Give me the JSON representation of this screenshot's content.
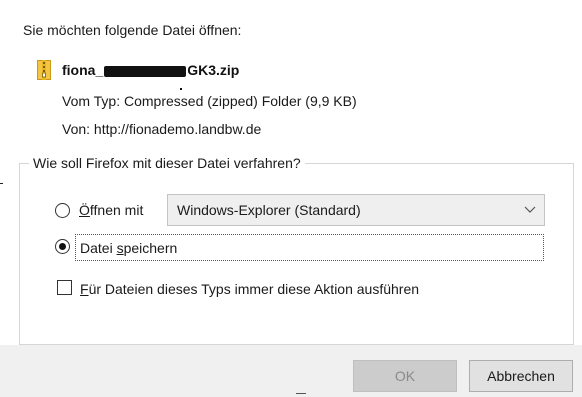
{
  "dialog": {
    "intro": "Sie möchten folgende Datei öffnen:",
    "file": {
      "name_start": "fiona_",
      "name_end": "GK3.zip",
      "icon": "zip-folder-icon",
      "type_label": "Vom Typ:",
      "type_value": "Compressed (zipped) Folder (9,9 KB)",
      "from_label": "Von:",
      "from_value": "http://fionademo.landbw.de"
    },
    "action_group": {
      "legend": "Wie soll Firefox mit dieser Datei verfahren?",
      "open_with": {
        "accel": "Ö",
        "label_rest": "ffnen mit",
        "checked": false,
        "app_selected": "Windows-Explorer (Standard)"
      },
      "save_file": {
        "label_pre": "Datei ",
        "accel": "s",
        "label_post": "peichern",
        "checked": true
      },
      "remember": {
        "accel": "F",
        "label_rest": "ür Dateien dieses Typs immer diese Aktion ausführen",
        "checked": false
      }
    },
    "buttons": {
      "ok": "OK",
      "cancel": "Abbrechen"
    }
  },
  "colors": {
    "button_bar": "#f0f0f0",
    "select_bg": "#efefef",
    "ok_disabled_text": "#8a8a8a"
  }
}
